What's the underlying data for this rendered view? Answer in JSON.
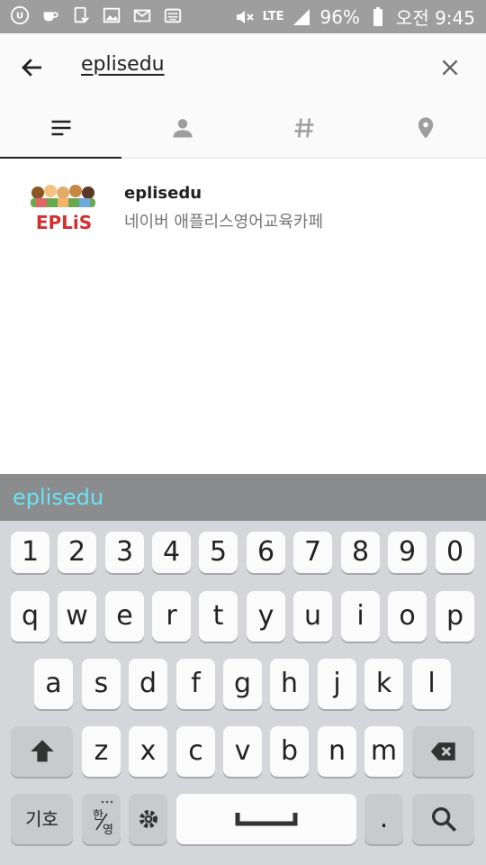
{
  "status_bar": {
    "battery": "96%",
    "time": "오전 9:45",
    "network": "LTE"
  },
  "search": {
    "query": "eplisedu"
  },
  "tabs": [
    {
      "name": "all",
      "icon": "list-icon",
      "active": true
    },
    {
      "name": "people",
      "icon": "person-icon"
    },
    {
      "name": "tags",
      "icon": "hashtag-icon"
    },
    {
      "name": "places",
      "icon": "location-icon"
    }
  ],
  "results": [
    {
      "title": "eplisedu",
      "subtitle": "네이버 애플리스영어교육카페",
      "logo_text": "EPLiS"
    }
  ],
  "keyboard": {
    "suggestion": "eplisedu",
    "numbers": [
      "1",
      "2",
      "3",
      "4",
      "5",
      "6",
      "7",
      "8",
      "9",
      "0"
    ],
    "row1": [
      "q",
      "w",
      "e",
      "r",
      "t",
      "y",
      "u",
      "i",
      "o",
      "p"
    ],
    "row2": [
      "a",
      "s",
      "d",
      "f",
      "g",
      "h",
      "j",
      "k",
      "l"
    ],
    "row3": [
      "z",
      "x",
      "c",
      "v",
      "b",
      "n",
      "m"
    ],
    "symbols_label": "기호",
    "lang_label_top": "한",
    "lang_label_bottom": "영",
    "period": "."
  },
  "colors": {
    "status_bar": "#9e9e9e",
    "suggestion_text": "#69e3f5",
    "keyboard_bg": "#d4d6d9"
  }
}
